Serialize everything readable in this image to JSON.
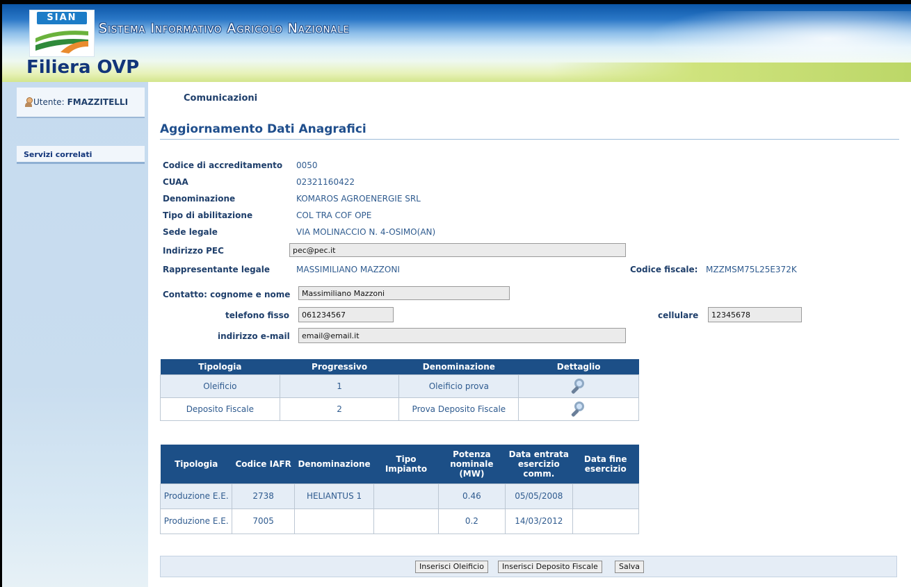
{
  "header": {
    "logo_text": "SIAN",
    "system_title": "Sistema Informativo Agricolo Nazionale",
    "app_title": "Filiera OVP"
  },
  "sidebar": {
    "user_label": "Utente:",
    "user_name": "FMAZZITELLI",
    "links": [
      {
        "label": "Servizi correlati"
      }
    ]
  },
  "breadcrumb": "Comunicazioni",
  "page_title": "Aggiornamento Dati Anagrafici",
  "info": {
    "codice_label": "Codice di accreditamento",
    "codice_value": "0050",
    "cuaa_label": "CUAA",
    "cuaa_value": "02321160422",
    "denominazione_label": "Denominazione",
    "denominazione_value": "KOMAROS AGROENERGIE SRL",
    "tipo_label": "Tipo di abilitazione",
    "tipo_value": "COL TRA COF OPE",
    "sede_label": "Sede legale",
    "sede_value": "VIA MOLINACCIO N. 4-OSIMO(AN)",
    "pec_label": "Indirizzo PEC",
    "pec_value": "pec@pec.it",
    "rappresentante_label": "Rappresentante legale",
    "rappresentante_value": "MASSIMILIANO MAZZONI",
    "cf_label": "Codice fiscale:",
    "cf_value": "MZZMSM75L25E372K"
  },
  "contact": {
    "nome_label": "Contatto: cognome e nome",
    "nome_value": "Massimiliano Mazzoni",
    "telefono_label": "telefono fisso",
    "telefono_value": "061234567",
    "cellulare_label": "cellulare",
    "cellulare_value": "12345678",
    "email_label": "indirizzo e-mail",
    "email_value": "email@email.it"
  },
  "table1": {
    "headers": [
      "Tipologia",
      "Progressivo",
      "Denominazione",
      "Dettaglio"
    ],
    "rows": [
      [
        "Oleificio",
        "1",
        "Oleificio prova"
      ],
      [
        "Deposito Fiscale",
        "2",
        "Prova Deposito Fiscale"
      ]
    ]
  },
  "table2": {
    "headers": [
      "Tipologia",
      "Codice IAFR",
      "Denominazione",
      "Tipo Impianto",
      "Potenza nominale (MW)",
      "Data entrata esercizio comm.",
      "Data fine esercizio"
    ],
    "rows": [
      [
        "Produzione E.E.",
        "2738",
        "HELIANTUS 1",
        "",
        "0.46",
        "05/05/2008",
        ""
      ],
      [
        "Produzione E.E.",
        "7005",
        "",
        "",
        "0.2",
        "14/03/2012",
        ""
      ]
    ]
  },
  "buttons": {
    "inserisci_oleificio": "Inserisci Oleificio",
    "inserisci_deposito": "Inserisci Deposito Fiscale",
    "salva": "Salva"
  }
}
